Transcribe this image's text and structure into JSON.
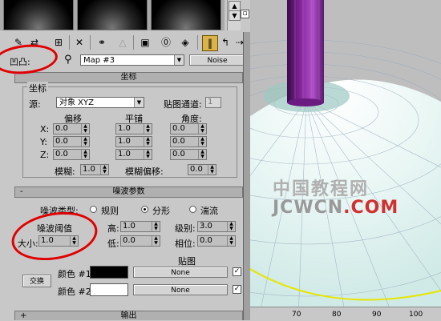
{
  "material_editor": {
    "bump_label": "凹凸:",
    "map_name": "Map #3",
    "map_type": "Noise"
  },
  "coordinates": {
    "title": "坐标",
    "group_title": "坐标",
    "source_label": "源:",
    "source_value": "对象 XYZ",
    "map_channel_label": "贴图通道:",
    "map_channel_value": "1",
    "offset_label": "偏移",
    "tiling_label": "平铺",
    "angle_label": "角度:",
    "axes": [
      "X:",
      "Y:",
      "Z:"
    ],
    "offset": [
      "0.0",
      "0.0",
      "0.0"
    ],
    "tiling": [
      "1.0",
      "1.0",
      "1.0"
    ],
    "angle": [
      "0.0",
      "0.0",
      "0.0"
    ],
    "blur_label": "模糊:",
    "blur_value": "1.0",
    "blur_offset_label": "模糊偏移:",
    "blur_offset_value": "0.0"
  },
  "noise_params": {
    "title": "噪波参数",
    "toggle": "-",
    "type_label": "噪波类型:",
    "types": [
      "规则",
      "分形",
      "湍流"
    ],
    "selected_type": "分形",
    "threshold_label": "噪波阈值",
    "high_label": "高:",
    "high_value": "1.0",
    "low_label": "低:",
    "low_value": "0.0",
    "levels_label": "级别:",
    "levels_value": "3.0",
    "phase_label": "相位:",
    "phase_value": "0.0",
    "size_label": "大小:",
    "size_value": "1.0",
    "maps_label": "贴图",
    "swap_label": "交换",
    "color1_label": "颜色 #1",
    "color1": "#000000",
    "color1_map": "None",
    "color2_label": "颜色 #2",
    "color2": "#ffffff",
    "color2_map": "None"
  },
  "output": {
    "title": "输出",
    "toggle": "+"
  },
  "watermark": {
    "line1": "中国教程网",
    "line2_a": "JCWCN",
    "line2_b": ".COM"
  },
  "ruler": {
    "ticks": [
      "70",
      "80",
      "90",
      "100"
    ]
  },
  "toolbar_icons": [
    "pick-material-icon",
    "put-to-scene-icon",
    "assign-material-icon",
    "reset-icon",
    "copy-icon",
    "unique-icon",
    "put-to-library-icon",
    "material-id-icon",
    "show-map-icon",
    "show-end-result-icon",
    "go-to-parent-icon",
    "go-forward-icon"
  ]
}
